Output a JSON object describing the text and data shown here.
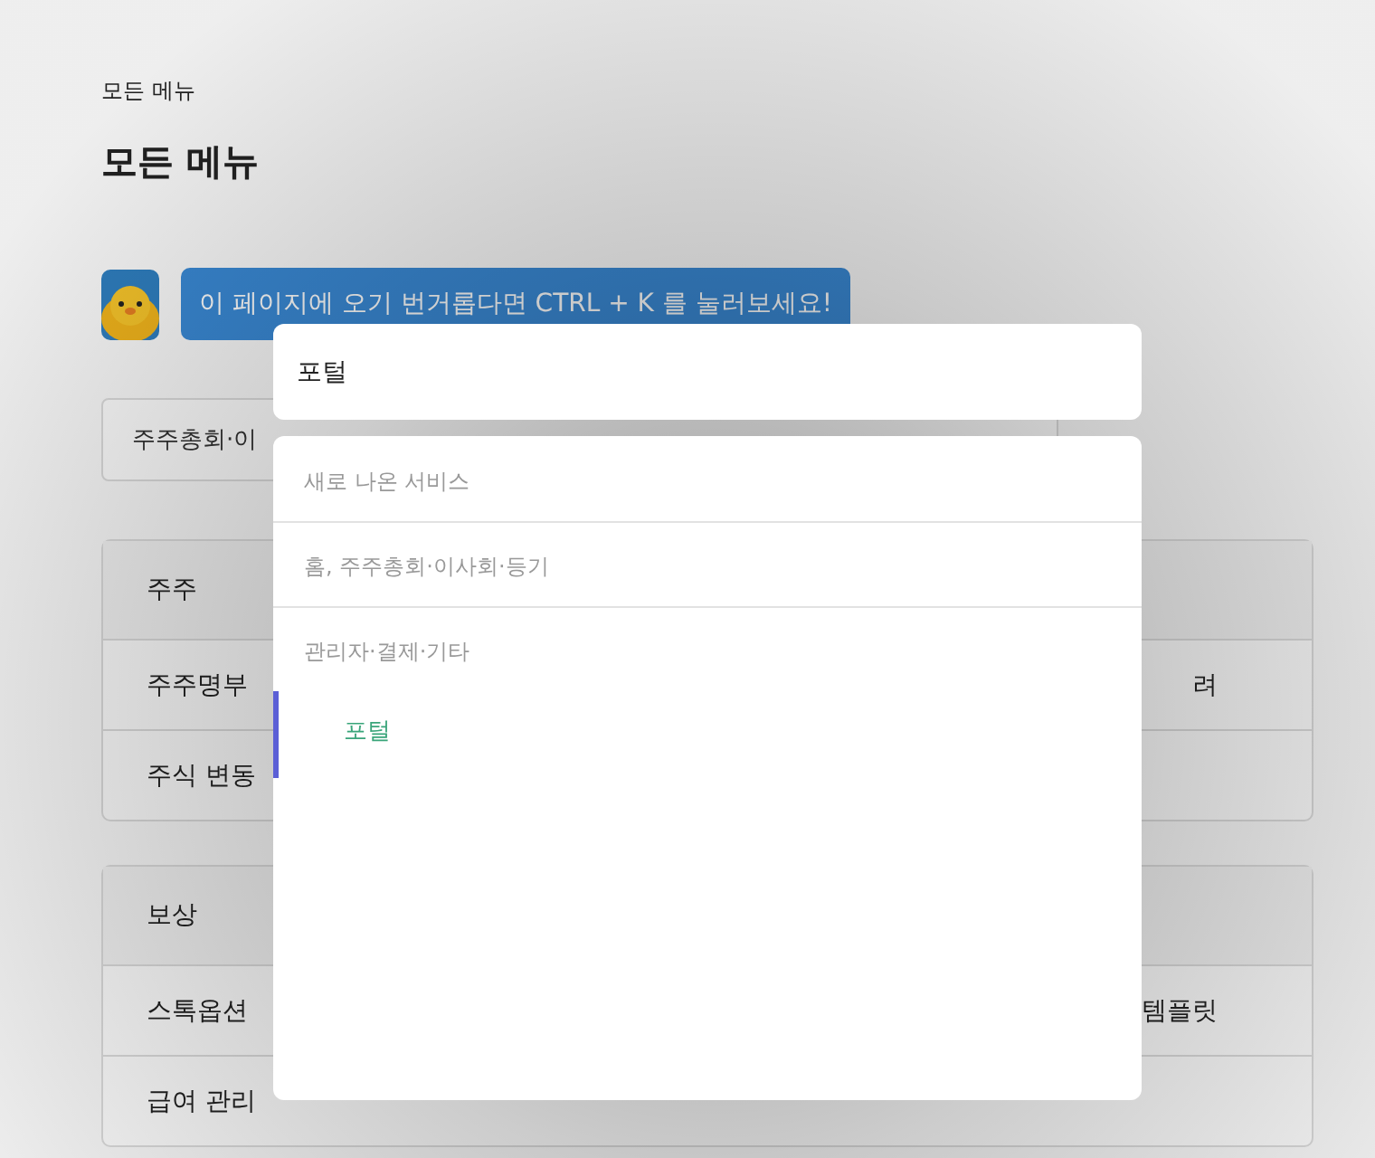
{
  "breadcrumb": "모든 메뉴",
  "title": "모든 메뉴",
  "banner": {
    "text": "이 페이지에 오기 번거롭다면 CTRL + K 를 눌러보세요!"
  },
  "tabs": [
    {
      "label": "주주총회·이"
    }
  ],
  "cards": [
    {
      "header": "주주",
      "rows": [
        {
          "left": "주주명부",
          "right": "려"
        },
        {
          "left": "주식 변동"
        }
      ]
    },
    {
      "header": "보상",
      "rows": [
        {
          "left": "스톡옵션",
          "right": "템플릿"
        },
        {
          "left": "급여 관리"
        }
      ]
    }
  ],
  "palette": {
    "search": {
      "value": "포털"
    },
    "groups": [
      {
        "title": "새로 나온 서비스"
      },
      {
        "title": "홈, 주주총회·이사회·등기"
      },
      {
        "title": "관리자·결제·기타",
        "items": [
          {
            "label": "포털",
            "selected": true
          }
        ]
      }
    ]
  }
}
